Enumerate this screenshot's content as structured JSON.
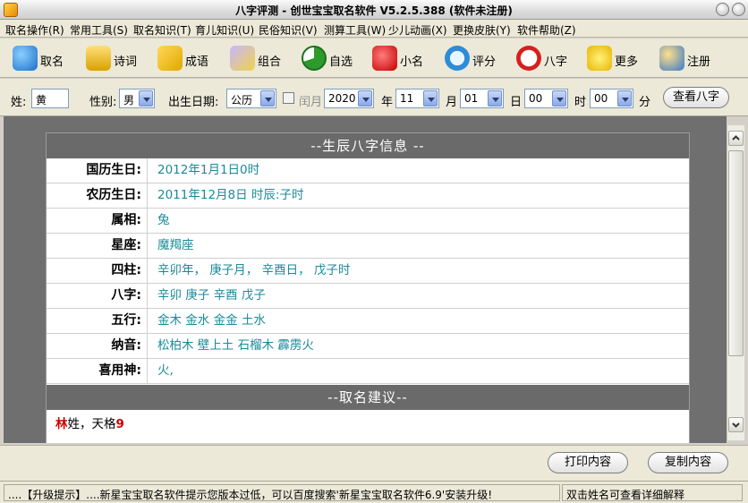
{
  "window": {
    "title": "八字评测 - 创世宝宝取名软件 V5.2.5.388 (软件未注册)"
  },
  "menu": [
    "取名操作(R)",
    "常用工具(S)",
    "取名知识(T)",
    "育儿知识(U)",
    "民俗知识(V)",
    "测算工具(W)",
    "少儿动画(X)",
    "更换皮肤(Y)",
    "软件帮助(Z)"
  ],
  "toolbar": [
    {
      "label": "取名",
      "icon": "people-icon"
    },
    {
      "label": "诗词",
      "icon": "scroll-icon"
    },
    {
      "label": "成语",
      "icon": "book-icon"
    },
    {
      "label": "组合",
      "icon": "shapes-icon"
    },
    {
      "label": "自选",
      "icon": "pie-icon"
    },
    {
      "label": "小名",
      "icon": "heart-icon"
    },
    {
      "label": "评分",
      "icon": "magnifier-icon"
    },
    {
      "label": "八字",
      "icon": "clock-icon"
    },
    {
      "label": "更多",
      "icon": "star-icon"
    },
    {
      "label": "注册",
      "icon": "users-icon"
    }
  ],
  "form": {
    "surname_label": "姓:",
    "surname_value": "黄",
    "gender_label": "性别:",
    "gender_value": "男",
    "birth_label": "出生日期:",
    "calendar_value": "公历",
    "leap_month_label": "闰月",
    "year_value": "2020",
    "year_label": "年",
    "month_value": "11",
    "month_label": "月",
    "day_value": "01",
    "day_label": "日",
    "hour_value": "00",
    "hour_label": "时",
    "minute_value": "00",
    "minute_label": "分",
    "view_bazi_button": "查看八字"
  },
  "bazi": {
    "header": "--生辰八字信息 --",
    "rows": [
      {
        "key": "国历生日:",
        "value": "2012年1月1日0时"
      },
      {
        "key": "农历生日:",
        "value": "2011年12月8日 时辰:子时"
      },
      {
        "key": "属相:",
        "value": "兔"
      },
      {
        "key": "星座:",
        "value": "魔羯座"
      },
      {
        "key": "四柱:",
        "value": "辛卯年， 庚子月， 辛酉日， 戊子时"
      },
      {
        "key": "八字:",
        "value": "辛卯 庚子 辛酉 戊子"
      },
      {
        "key": "五行:",
        "value": "金木 金水 金金 土水"
      },
      {
        "key": "纳音:",
        "value": "松柏木 壁上土 石榴木 霹雳火"
      },
      {
        "key": "喜用神:",
        "value": "火,"
      }
    ]
  },
  "naming": {
    "header": "--取名建议--",
    "surname_char": "林",
    "suggestion_text": "姓，天格",
    "suggestion_number": "9"
  },
  "bottom_buttons": {
    "print": "打印内容",
    "copy": "复制内容"
  },
  "status": {
    "left": "....【升级提示】....新星宝宝取名软件提示您版本过低，可以百度搜索'新星宝宝取名软件6.9'安装升级!",
    "right": "双击姓名可查看详细解释"
  },
  "colors": {
    "value_text": "#1a8a99",
    "section_header_bg": "#6a6a6a",
    "highlight_red": "#cc0000"
  }
}
